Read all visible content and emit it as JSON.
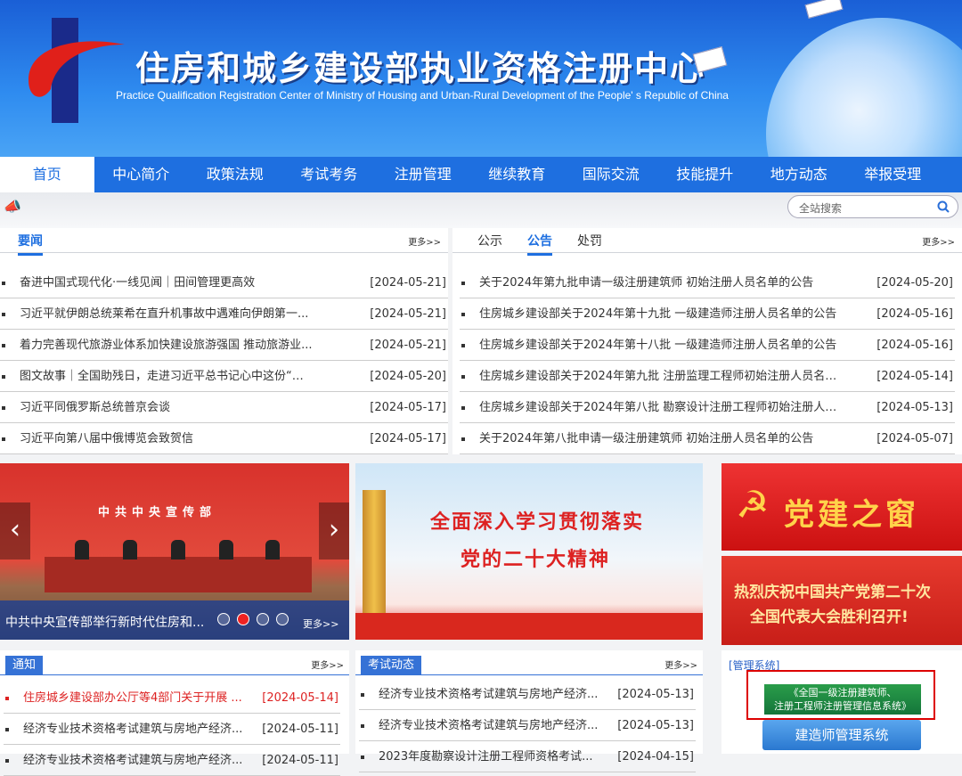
{
  "header": {
    "title": "住房和城乡建设部执业资格注册中心",
    "subtitle": "Practice Qualification Registration Center of Ministry of Housing and Urban-Rural Development of the People' s Republic of China"
  },
  "nav": {
    "items": [
      "首页",
      "中心简介",
      "政策法规",
      "考试考务",
      "注册管理",
      "继续教育",
      "国际交流",
      "技能提升",
      "地方动态",
      "举报受理"
    ],
    "active_index": 0
  },
  "search": {
    "placeholder": "全站搜索"
  },
  "news": {
    "tab": "要闻",
    "more": "更多>>",
    "items": [
      {
        "title": "奋进中国式现代化·一线见闻｜田间管理更高效",
        "date": "[2024-05-21]"
      },
      {
        "title": "习近平就伊朗总统莱希在直升机事故中遇难向伊朗第一...",
        "date": "[2024-05-21]"
      },
      {
        "title": "着力完善现代旅游业体系加快建设旅游强国 推动旅游业...",
        "date": "[2024-05-21]"
      },
      {
        "title": "图文故事｜全国助残日，走进习近平总书记心中这份“春...",
        "date": "[2024-05-20]"
      },
      {
        "title": "习近平同俄罗斯总统普京会谈",
        "date": "[2024-05-17]"
      },
      {
        "title": "习近平向第八届中俄博览会致贺信",
        "date": "[2024-05-17]"
      }
    ]
  },
  "notices": {
    "tabs": [
      "公示",
      "公告",
      "处罚"
    ],
    "active_index": 1,
    "more": "更多>>",
    "items": [
      {
        "title": "关于2024年第九批申请一级注册建筑师 初始注册人员名单的公告",
        "date": "[2024-05-20]"
      },
      {
        "title": "住房城乡建设部关于2024年第十九批 一级建造师注册人员名单的公告",
        "date": "[2024-05-16]"
      },
      {
        "title": "住房城乡建设部关于2024年第十八批 一级建造师注册人员名单的公告",
        "date": "[2024-05-16]"
      },
      {
        "title": "住房城乡建设部关于2024年第九批 注册监理工程师初始注册人员名单...",
        "date": "[2024-05-14]"
      },
      {
        "title": "住房城乡建设部关于2024年第八批 勘察设计注册工程师初始注册人员...",
        "date": "[2024-05-13]"
      },
      {
        "title": "关于2024年第八批申请一级注册建筑师 初始注册人员名单的公告",
        "date": "[2024-05-07]"
      }
    ]
  },
  "slider": {
    "backdrop_text": "中共中央宣传部",
    "caption": "中共中央宣传部举行新时代住房和...",
    "dots": [
      "1",
      "2",
      "3",
      "4"
    ],
    "active_dot": 1,
    "more": "更多>>",
    "prev": "‹",
    "next": "›"
  },
  "promo": {
    "line1": "全面深入学习贯彻落实",
    "line2": "党的二十大精神"
  },
  "party": {
    "banner1": "党建之窗",
    "banner2_line1": "热烈庆祝中国共产党第二十次",
    "banner2_line2": "全国代表大会胜利召开!"
  },
  "notice_box": {
    "title": "通知",
    "more": "更多>>",
    "items": [
      {
        "title": "住房城乡建设部办公厅等4部门关于开展 ...",
        "date": "[2024-05-14]",
        "highlight": true
      },
      {
        "title": "经济专业技术资格考试建筑与房地产经济...",
        "date": "[2024-05-11]",
        "highlight": false
      },
      {
        "title": "经济专业技术资格考试建筑与房地产经济...",
        "date": "[2024-05-11]",
        "highlight": false
      }
    ]
  },
  "exam_box": {
    "title": "考试动态",
    "more": "更多>>",
    "items": [
      {
        "title": "经济专业技术资格考试建筑与房地产经济...",
        "date": "[2024-05-13]"
      },
      {
        "title": "经济专业技术资格考试建筑与房地产经济...",
        "date": "[2024-05-13]"
      },
      {
        "title": "2023年度勘察设计注册工程师资格考试...",
        "date": "[2024-04-15]"
      }
    ]
  },
  "management": {
    "label": "[管理系统]",
    "green_line1": "《全国一级注册建筑师、",
    "green_line2": "注册工程师注册管理信息系统》",
    "blue_label": "建造师管理系统"
  }
}
